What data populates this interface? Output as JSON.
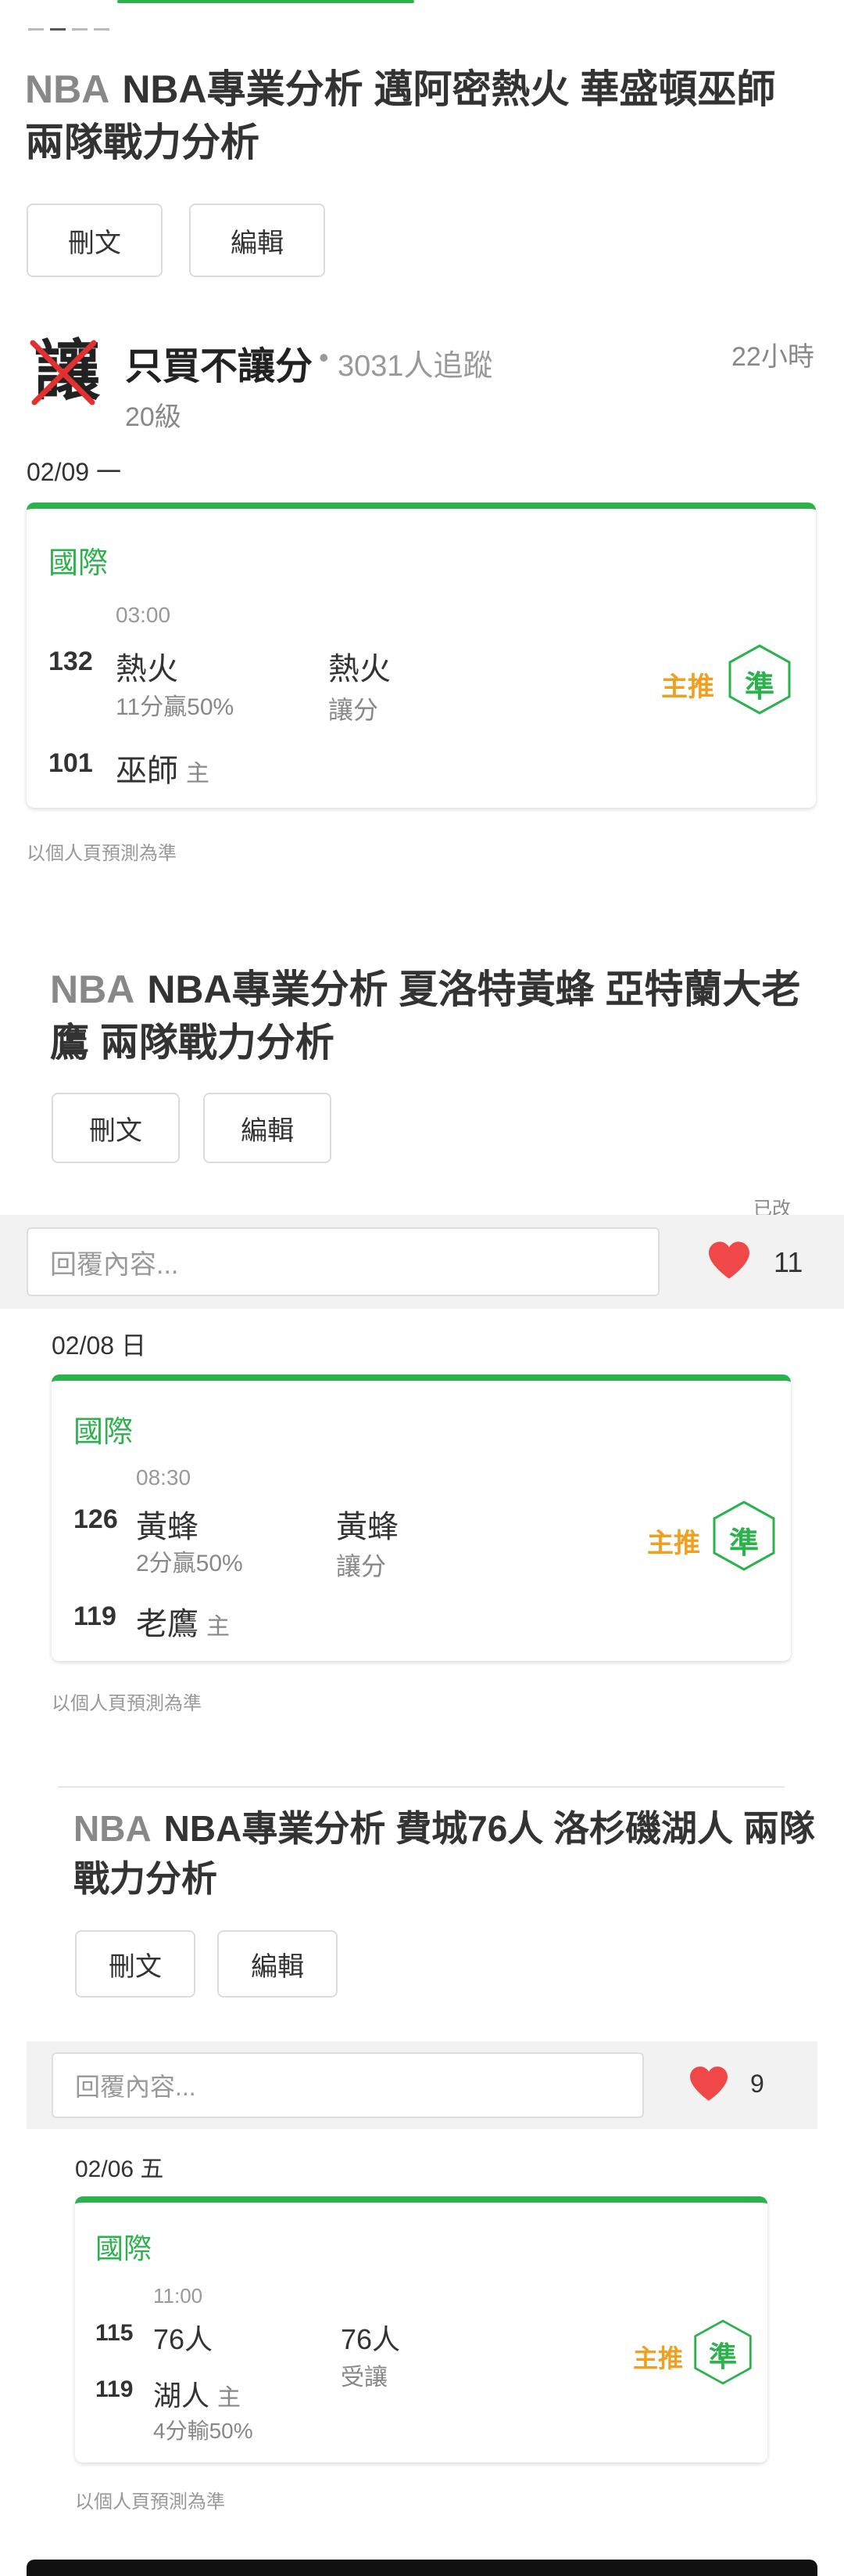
{
  "colors": {
    "accent_green": "#2bb24c",
    "pick_orange": "#f0a020",
    "heart_red": "#f04848"
  },
  "posts": [
    {
      "category": "NBA",
      "title": "NBA專業分析 邁阿密熱火 華盛頓巫師 兩隊戰力分析",
      "delete_label": "刪文",
      "edit_label": "編輯"
    },
    {
      "category": "NBA",
      "title": "NBA專業分析 夏洛特黃蜂 亞特蘭大老鷹 兩隊戰力分析",
      "delete_label": "刪文",
      "edit_label": "編輯"
    },
    {
      "category": "NBA",
      "title": "NBA專業分析 費城76人 洛杉磯湖人 兩隊戰力分析",
      "delete_label": "刪文",
      "edit_label": "編輯"
    }
  ],
  "author": {
    "avatar_char": "讓",
    "avatar_icon": "crossed-out-character-icon",
    "name": "只買不讓分",
    "separator": "•",
    "followers": "3031人追蹤",
    "level": "20級",
    "posted_ago": "22小時"
  },
  "predictions": [
    {
      "date": "02/09 一",
      "league": "國際",
      "time": "03:00",
      "away_num": "132",
      "away_team": "熱火",
      "away_sub": "11分贏50%",
      "home_num": "101",
      "home_team": "巫師",
      "home_tag": "主",
      "pick_team": "熱火",
      "pick_type": "讓分",
      "main_pick_label": "主推",
      "result_label": "準"
    },
    {
      "date": "02/08 日",
      "league": "國際",
      "time": "08:30",
      "away_num": "126",
      "away_team": "黃蜂",
      "away_sub": "2分贏50%",
      "home_num": "119",
      "home_team": "老鷹",
      "home_tag": "主",
      "pick_team": "黃蜂",
      "pick_type": "讓分",
      "main_pick_label": "主推",
      "result_label": "準"
    },
    {
      "date": "02/06 五",
      "league": "國際",
      "time": "11:00",
      "away_num": "115",
      "away_team": "76人",
      "home_num": "119",
      "home_team": "湖人",
      "home_tag": "主",
      "home_sub": "4分輸50%",
      "pick_team": "76人",
      "pick_type": "受讓",
      "main_pick_label": "主推",
      "result_label": "準"
    }
  ],
  "footnote": "以個人頁預測為準",
  "edited_label": "已改",
  "replies": [
    {
      "placeholder": "回覆內容...",
      "likes": "11",
      "like_icon": "heart-icon"
    },
    {
      "placeholder": "回覆內容...",
      "likes": "9",
      "like_icon": "heart-icon"
    }
  ]
}
